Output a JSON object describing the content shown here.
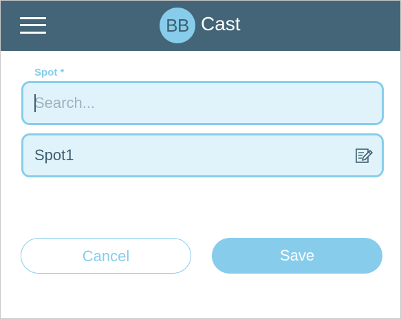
{
  "header": {
    "logo_badge": "BB",
    "logo_text": "Cast",
    "background_color": "#446577",
    "accent_color": "#87cdeb",
    "menu_icon": "hamburger-menu-icon"
  },
  "form": {
    "spot_label": "Spot *",
    "search": {
      "value": "",
      "placeholder": "Search..."
    },
    "selected_spot": {
      "label": "Spot1",
      "icon": "edit-note-icon"
    }
  },
  "actions": {
    "cancel_label": "Cancel",
    "save_label": "Save"
  }
}
